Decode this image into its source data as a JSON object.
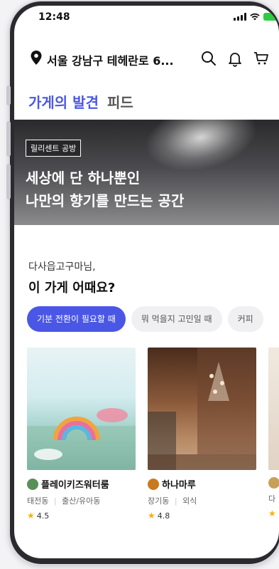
{
  "status": {
    "time": "12:48"
  },
  "header": {
    "location": "서울 강남구 테헤란로 6..."
  },
  "tabs": [
    {
      "label": "가게의 발견",
      "active": true
    },
    {
      "label": "피드",
      "active": false
    }
  ],
  "banner": {
    "tag": "릴리센트 공방",
    "line1": "세상에 단 하나뿐인",
    "line2": "나만의 향기를 만드는 공간"
  },
  "section": {
    "greeting": "다사읍고구마님,",
    "title": "이 가게 어때요?"
  },
  "chips": [
    {
      "label": "기분 전환이 필요할 때",
      "active": true
    },
    {
      "label": "뭐 먹을지 고민일 때",
      "active": false
    },
    {
      "label": "커피",
      "active": false
    }
  ],
  "cards": [
    {
      "name": "플레이키즈워터룸",
      "location": "태전동",
      "category": "출산/유아동",
      "rating": "4.5",
      "logo_color": "#5a8f5a"
    },
    {
      "name": "하나마루",
      "location": "장기동",
      "category": "외식",
      "rating": "4.8",
      "logo_color": "#c97a1e"
    },
    {
      "name": "",
      "location": "다",
      "category": "",
      "rating": "",
      "logo_color": "#c9a05a"
    }
  ],
  "colors": {
    "accent": "#4a57e6",
    "star": "#f5b400"
  },
  "icons": [
    "location-pin-icon",
    "search-icon",
    "bell-icon",
    "cart-icon",
    "star-icon"
  ]
}
